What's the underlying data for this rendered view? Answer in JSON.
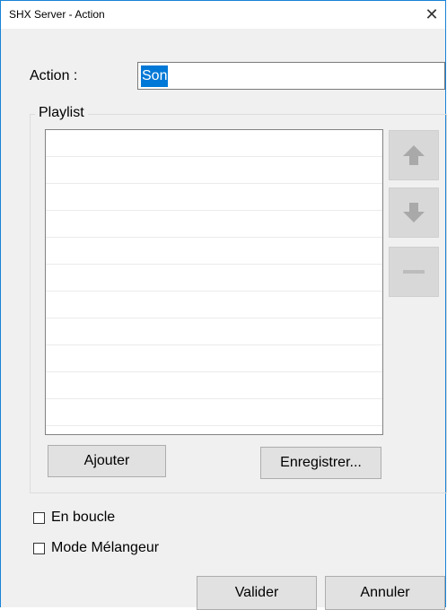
{
  "window": {
    "title": "SHX Server - Action",
    "close_glyph": "✕"
  },
  "action": {
    "label": "Action :",
    "value": "Son"
  },
  "playlist": {
    "group_label": "Playlist",
    "rows": [
      "",
      "",
      "",
      "",
      "",
      "",
      "",
      "",
      "",
      "",
      ""
    ],
    "move_up_icon": "arrow-up-icon",
    "move_down_icon": "arrow-down-icon",
    "remove_icon": "minus-icon",
    "add_label": "Ajouter",
    "save_label": "Enregistrer..."
  },
  "options": {
    "loop_label": "En boucle",
    "loop_checked": false,
    "mixer_label": "Mode Mélangeur",
    "mixer_checked": false
  },
  "footer": {
    "ok_label": "Valider",
    "cancel_label": "Annuler"
  },
  "colors": {
    "accent": "#1883d7",
    "selection": "#0078d7",
    "disabled_button": "#d8d8d8"
  }
}
